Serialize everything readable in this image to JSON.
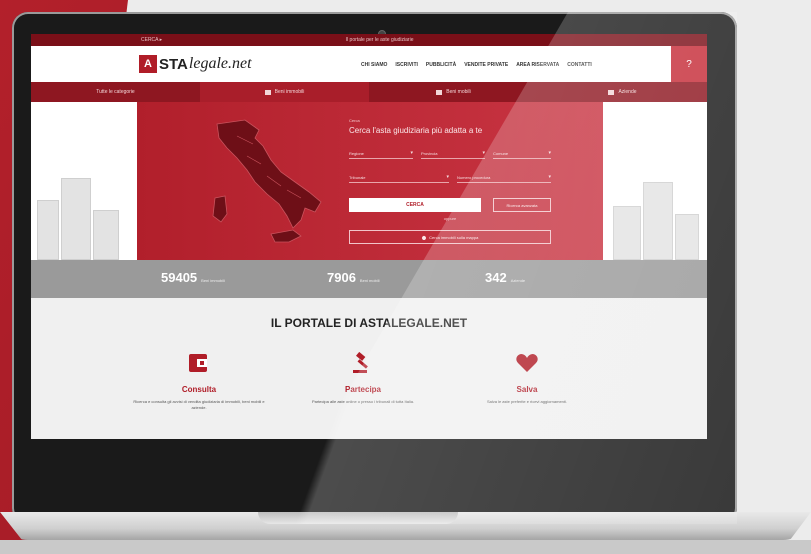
{
  "topbar": {
    "left": "CERCA ▸",
    "center": "Il portale per le aste giudiziarie"
  },
  "header": {
    "logo_box": "A",
    "logo_asta": "STA",
    "logo_legale": "legale.net",
    "nav": [
      "CHI SIAMO",
      "ISCRIVITI",
      "PUBBLICITÀ",
      "VENDITE PRIVATE",
      "AREA RISERVATA",
      "CONTATTI"
    ],
    "help": "?"
  },
  "categories": [
    {
      "label": "Tutte le categorie",
      "icon": "list-icon"
    },
    {
      "label": "Beni immobili",
      "icon": "building-icon"
    },
    {
      "label": "Beni mobili",
      "icon": "car-icon"
    },
    {
      "label": "Aziende",
      "icon": "factory-icon"
    }
  ],
  "search": {
    "pretitle": "Cerca",
    "title": "Cerca l'asta giudiziaria più adatta a te",
    "fields": [
      "Regione",
      "Provincia",
      "Comune",
      "Tribunale",
      "Numero procedura"
    ],
    "button": "CERCA",
    "advanced": "Ricerca avanzata",
    "or": "oppure",
    "map_button": "Cerca immobili sulla mappa"
  },
  "stats": [
    {
      "num": "59405",
      "label": "Beni immobili"
    },
    {
      "num": "7906",
      "label": "Beni mobili"
    },
    {
      "num": "342",
      "label": "Aziende"
    }
  ],
  "portal": {
    "title": "IL PORTALE DI ASTALEGALE.NET",
    "features": [
      {
        "title": "Consulta",
        "text": "Ricerca e consulta gli avvisi di vendita giudiziaria di immobili, beni mobili e aziende.",
        "icon": "wallet-icon"
      },
      {
        "title": "Partecipa",
        "text": "Partecipa alle aste online o presso i tribunali di tutta Italia.",
        "icon": "gavel-icon"
      },
      {
        "title": "Salva",
        "text": "Salva le aste preferite e ricevi aggiornamenti.",
        "icon": "heart-icon"
      }
    ]
  },
  "colors": {
    "brand": "#b01d28",
    "dark_brand": "#8e1721",
    "stats_bg": "#9a9a9a"
  }
}
